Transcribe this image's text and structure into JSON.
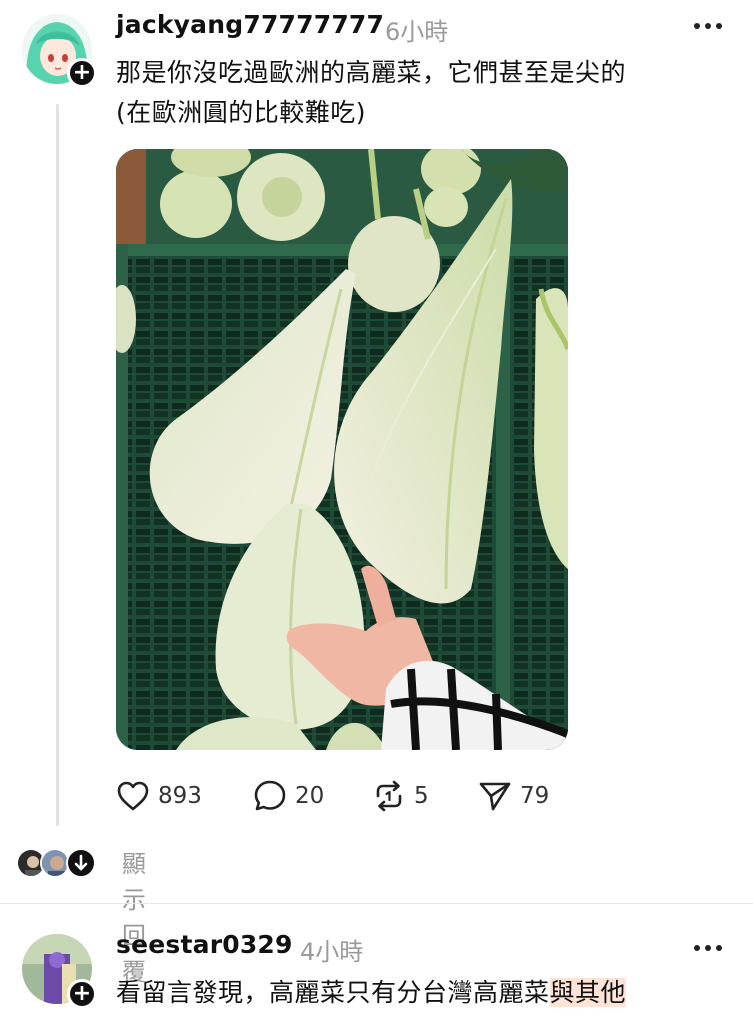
{
  "post1": {
    "username": "jackyang77777777",
    "time": "6小時",
    "text_line1": "那是你沒吃過歐洲的高麗菜，它們甚至是尖的",
    "text_line2": "(在歐洲圓的比較難吃)",
    "likes": "893",
    "comments": "20",
    "reposts": "5",
    "shares": "79"
  },
  "replies": {
    "label": "顯示回覆"
  },
  "post2": {
    "username": "seestar0329",
    "time": "4小時",
    "text_plain": "看留言發現，高麗菜只有分台灣高麗菜",
    "text_highlight": "與其他"
  },
  "icons": {
    "more": "more-dots-icon",
    "like": "heart-icon",
    "comment": "comment-bubble-icon",
    "repost": "repost-icon",
    "share": "send-icon",
    "follow": "plus-icon",
    "expand": "arrow-down-icon"
  },
  "colors": {
    "text": "#111111",
    "muted": "#9a9a9a",
    "highlight": "#fde4d6"
  }
}
